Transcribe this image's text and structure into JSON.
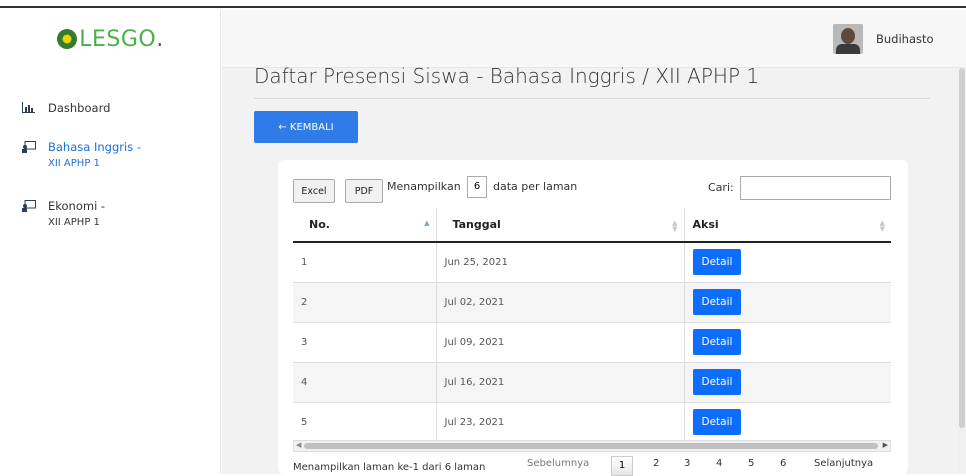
{
  "brand": {
    "logo_text": "LESGO",
    "logo_dot": "."
  },
  "user": {
    "name": "Budihasto"
  },
  "sidebar": {
    "items": [
      {
        "label": "Dashboard",
        "sub": "",
        "icon": "chart-icon",
        "active": false
      },
      {
        "label": "Bahasa Inggris -",
        "sub": "XII APHP 1",
        "icon": "board-icon",
        "active": true
      },
      {
        "label": "Ekonomi -",
        "sub": "XII APHP 1",
        "icon": "board-icon",
        "active": false
      }
    ]
  },
  "page": {
    "title": "Daftar Presensi Siswa - Bahasa Inggris / XII APHP 1",
    "back_label": "← KEMBALI"
  },
  "toolbar": {
    "excel_label": "Excel",
    "pdf_label": "PDF",
    "show_prefix": "Menampilkan",
    "page_length": "6",
    "show_suffix": "data per laman",
    "search_label": "Cari:",
    "search_value": ""
  },
  "table": {
    "columns": [
      "No.",
      "Tanggal",
      "Aksi"
    ],
    "rows": [
      {
        "no": "1",
        "tanggal": "Jun 25, 2021",
        "aksi": "Detail"
      },
      {
        "no": "2",
        "tanggal": "Jul 02, 2021",
        "aksi": "Detail"
      },
      {
        "no": "3",
        "tanggal": "Jul 09, 2021",
        "aksi": "Detail"
      },
      {
        "no": "4",
        "tanggal": "Jul 16, 2021",
        "aksi": "Detail"
      },
      {
        "no": "5",
        "tanggal": "Jul 23, 2021",
        "aksi": "Detail"
      }
    ]
  },
  "footer": {
    "info": "Menampilkan laman ke-1 dari 6 laman",
    "prev_label": "Sebelumnya",
    "pages": [
      "1",
      "2",
      "3",
      "4",
      "5",
      "6"
    ],
    "current_page": "1",
    "next_label": "Selanjutnya"
  },
  "colors": {
    "accent": "#2f7be8",
    "detail_button": "#0d6efd",
    "brand_green": "#49b04a"
  }
}
